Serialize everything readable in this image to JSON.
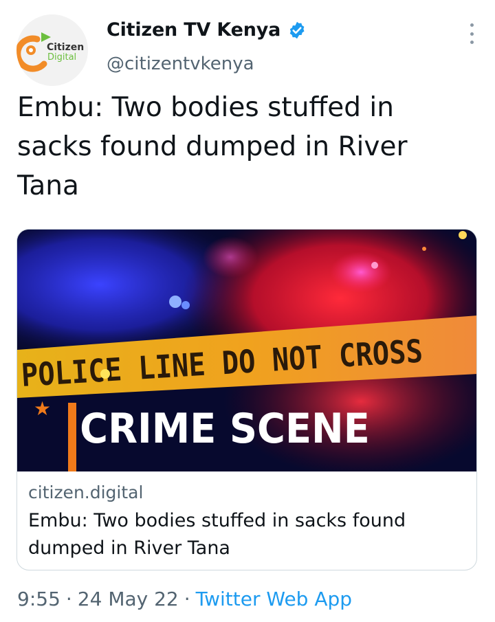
{
  "account": {
    "display_name": "Citizen TV Kenya",
    "handle": "@citizentvkenya",
    "verified": true,
    "avatar_logo_text_1": "Citizen",
    "avatar_logo_text_2": "Digital"
  },
  "tweet": {
    "text": "Embu: Two bodies stuffed in sacks found dumped in River Tana"
  },
  "card": {
    "image_text_tape": "POLICE LINE DO NOT CROSS",
    "image_text_main": "CRIME SCENE",
    "domain": "citizen.digital",
    "title": "Embu: Two bodies stuffed in sacks found dumped in River Tana"
  },
  "meta": {
    "time": "9:55",
    "separator": "·",
    "date": "24 May 22",
    "source": "Twitter Web App"
  },
  "colors": {
    "accent": "#1d9bf0",
    "logo_orange": "#f28c28",
    "logo_green": "#6cbf3f",
    "tape_yellow": "#f4b41a"
  },
  "icons": {
    "verified": "verified-badge-icon",
    "more": "more-options-icon"
  }
}
